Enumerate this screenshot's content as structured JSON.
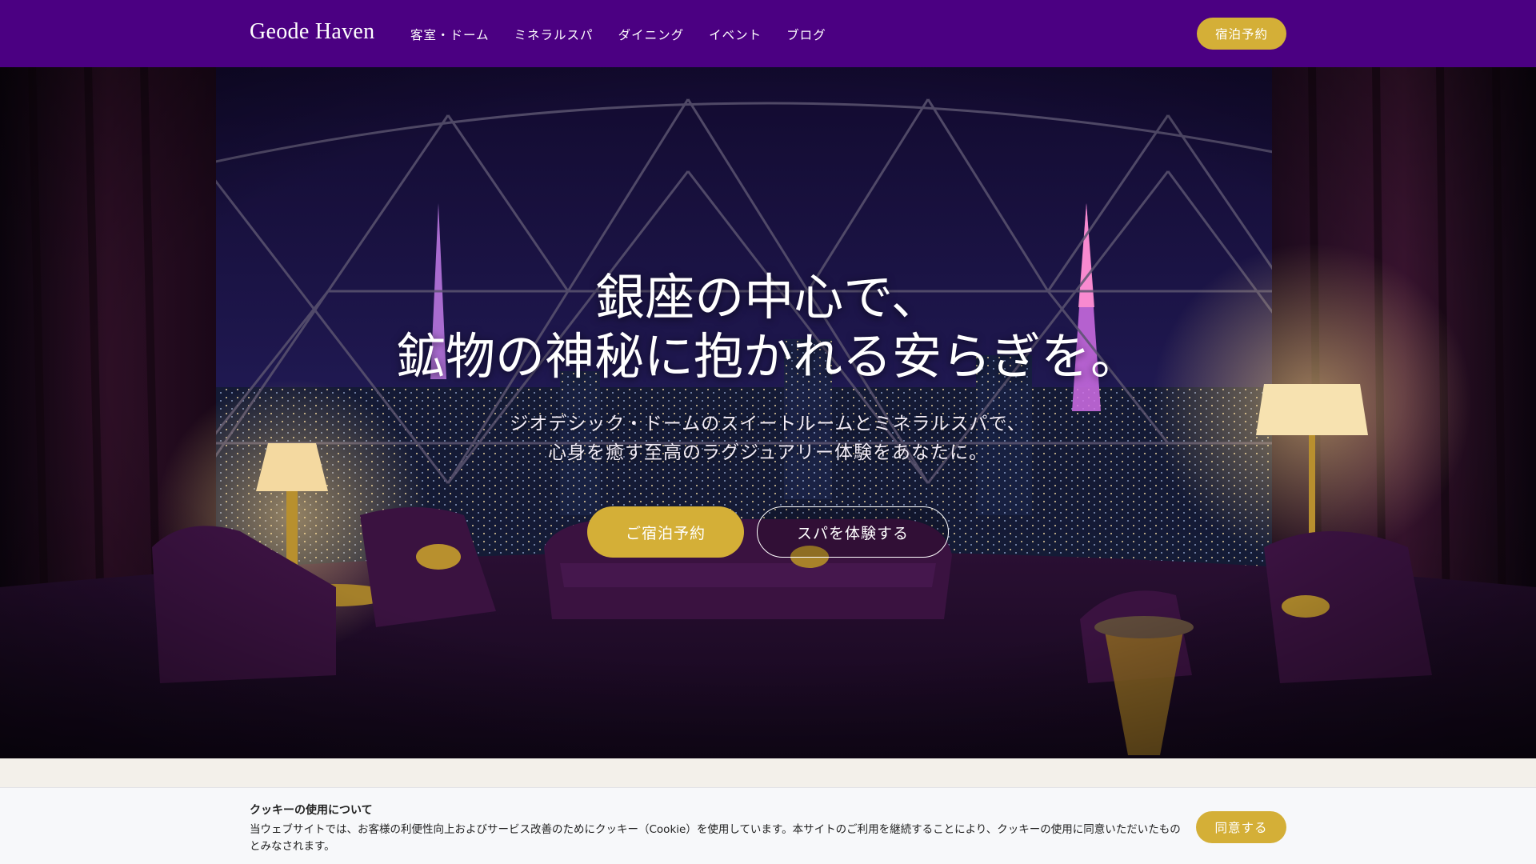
{
  "header": {
    "brand": "Geode Haven",
    "nav": [
      {
        "label": "客室・ドーム"
      },
      {
        "label": "ミネラルスパ"
      },
      {
        "label": "ダイニング"
      },
      {
        "label": "イベント"
      },
      {
        "label": "ブログ"
      }
    ],
    "cta_label": "宿泊予約"
  },
  "hero": {
    "title_line1": "銀座の中心で、",
    "title_line2": "鉱物の神秘に抱かれる安らぎを。",
    "subtitle_line1": "ジオデシック・ドームのスイートルームとミネラルスパで、",
    "subtitle_line2": "心身を癒す至高のラグジュアリー体験をあなたに。",
    "primary_button": "ご宿泊予約",
    "secondary_button": "スパを体験する",
    "image": "geodesic-dome-suite-night-city-view"
  },
  "cookie_banner": {
    "title": "クッキーの使用について",
    "body": "当ウェブサイトでは、お客様の利便性向上およびサービス改善のためにクッキー（Cookie）を使用しています。本サイトのご利用を継続することにより、クッキーの使用に同意いただいたものとみなされます。",
    "accept_label": "同意する"
  },
  "colors": {
    "header_bg": "#4b0082",
    "accent_gold": "#d4af37",
    "banner_bg": "#f7f8fa"
  }
}
